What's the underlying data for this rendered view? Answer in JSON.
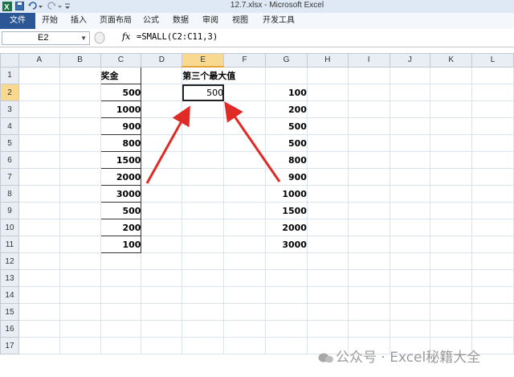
{
  "window": {
    "title": "12.7.xlsx - Microsoft Excel"
  },
  "ribbon": {
    "tabs": [
      "文件",
      "开始",
      "插入",
      "页面布局",
      "公式",
      "数据",
      "审阅",
      "视图",
      "开发工具"
    ]
  },
  "formula_bar": {
    "name_box": "E2",
    "fx_label": "fx",
    "formula": "=SMALL(C2:C11,3)"
  },
  "sheet": {
    "columns": [
      "A",
      "B",
      "C",
      "D",
      "E",
      "F",
      "G",
      "H",
      "I",
      "J",
      "K",
      "L"
    ],
    "rows": [
      "1",
      "2",
      "3",
      "4",
      "5",
      "6",
      "7",
      "8",
      "9",
      "10",
      "11",
      "12",
      "13",
      "14",
      "15",
      "16",
      "17"
    ],
    "selected_cell": "E2",
    "c_header": "奖金",
    "c_values": [
      "500",
      "1000",
      "900",
      "800",
      "1500",
      "2000",
      "3000",
      "500",
      "200",
      "100"
    ],
    "e1_label": "第三个最大值",
    "e2_value": "500",
    "g_values": [
      "100",
      "200",
      "500",
      "500",
      "800",
      "900",
      "1000",
      "1500",
      "2000",
      "3000"
    ]
  },
  "annotation": {
    "arrow_color": "#e02a26"
  },
  "watermark": {
    "text": "公众号 · Excel秘籍大全"
  }
}
